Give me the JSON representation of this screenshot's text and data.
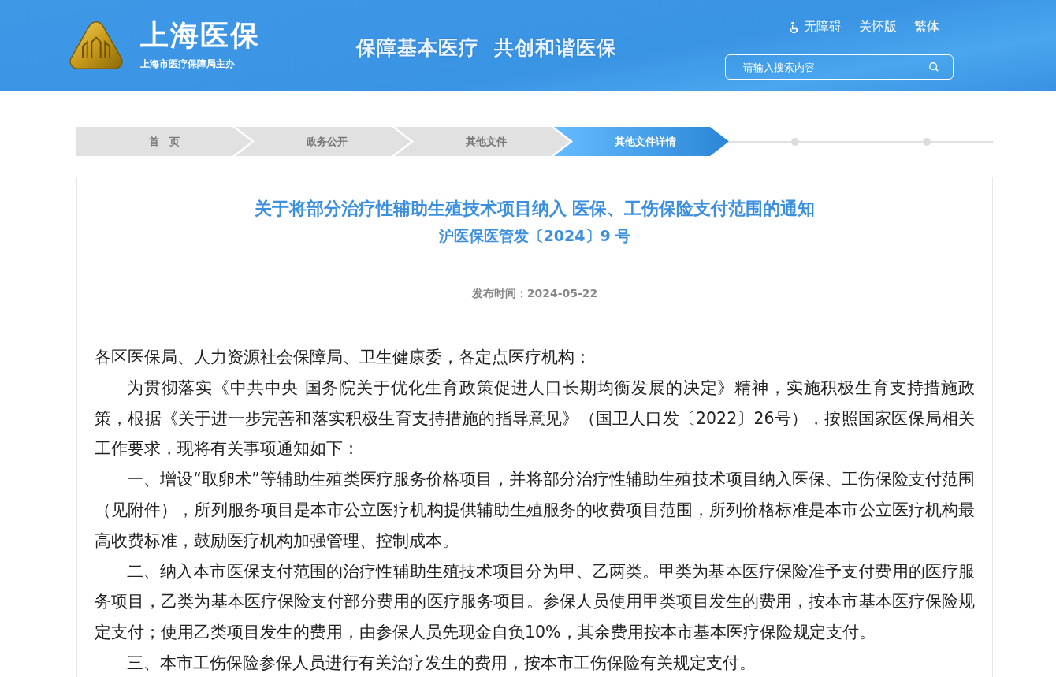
{
  "header": {
    "site_name": "上海医保",
    "site_subtitle": "上海市医疗保障局主办",
    "slogan": "保障基本医疗  共创和谐医保",
    "links": [
      {
        "label": "无障碍",
        "kind": "accessibility"
      },
      {
        "label": "关怀版",
        "kind": "plain"
      },
      {
        "label": "繁体",
        "kind": "plain"
      }
    ],
    "search": {
      "placeholder": "请输入搜索内容"
    }
  },
  "breadcrumb": [
    {
      "label": "首　页",
      "selected": false
    },
    {
      "label": "政务公开",
      "selected": false
    },
    {
      "label": "其他文件",
      "selected": false
    },
    {
      "label": "其他文件详情",
      "selected": true
    }
  ],
  "article": {
    "title": "关于将部分治疗性辅助生殖技术项目纳入 医保、工伤保险支付范围的通知",
    "doc_number": "沪医保医管发〔2024〕9 号",
    "published": "发布时间：2024-05-22",
    "paragraphs": [
      {
        "text": "各区医保局、人力资源社会保障局、卫生健康委，各定点医疗机构：",
        "indent": false
      },
      {
        "text": "为贯彻落实《中共中央 国务院关于优化生育政策促进人口长期均衡发展的决定》精神，实施积极生育支持措施政策，根据《关于进一步完善和落实积极生育支持措施的指导意见》（国卫人口发〔2022〕26号），按照国家医保局相关工作要求，现将有关事项通知如下：",
        "indent": true
      },
      {
        "text": "一、增设“取卵术”等辅助生殖类医疗服务价格项目，并将部分治疗性辅助生殖技术项目纳入医保、工伤保险支付范围（见附件），所列服务项目是本市公立医疗机构提供辅助生殖服务的收费项目范围，所列价格标准是本市公立医疗机构最高收费标准，鼓励医疗机构加强管理、控制成本。",
        "indent": true
      },
      {
        "text": "二、纳入本市医保支付范围的治疗性辅助生殖技术项目分为甲、乙两类。甲类为基本医疗保险准予支付费用的医疗服务项目，乙类为基本医疗保险支付部分费用的医疗服务项目。参保人员使用甲类项目发生的费用，按本市基本医疗保险规定支付；使用乙类项目发生的费用，由参保人员先现金自负10%，其余费用按本市基本医疗保险规定支付。",
        "indent": true
      },
      {
        "text": "三、本市工伤保险参保人员进行有关治疗发生的费用，按本市工伤保险有关规定支付。",
        "indent": true
      }
    ]
  }
}
